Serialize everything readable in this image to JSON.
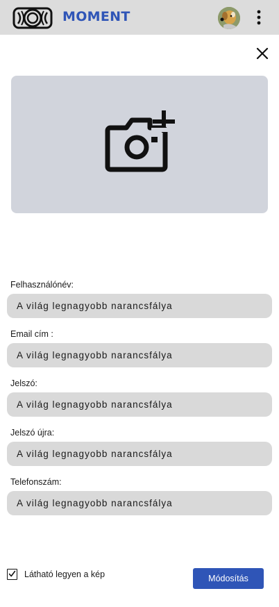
{
  "header": {
    "brand": "MOMENT",
    "logo_icon": "moment-camera-logo",
    "avatar_icon": "user-avatar",
    "menu_icon": "more-vertical-icon"
  },
  "dialog": {
    "close_icon": "close-icon",
    "photo_icon": "add-photo-icon"
  },
  "form": {
    "fields": [
      {
        "label": "Felhasználónév:",
        "value": "A világ legnagyobb narancsfálya"
      },
      {
        "label": "Email cím :",
        "value": "A világ legnagyobb narancsfálya"
      },
      {
        "label": "Jelszó:",
        "value": "A világ legnagyobb narancsfálya"
      },
      {
        "label": "Jelszó újra:",
        "value": "A világ legnagyobb narancsfálya"
      },
      {
        "label": "Telefonszám:",
        "value": "A világ legnagyobb narancsfálya"
      }
    ],
    "visibility_checkbox": {
      "label": "Látható legyen a kép",
      "checked": true
    },
    "submit_label": "Módosítás"
  },
  "colors": {
    "brand": "#2f55b7",
    "header_bg": "#dcdcdc",
    "input_bg": "#d9d9d9",
    "photo_bg": "#d1d4dc"
  }
}
